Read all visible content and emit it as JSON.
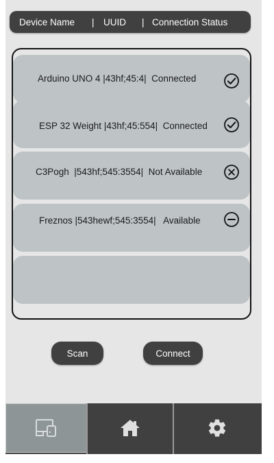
{
  "header": {
    "device_name_label": "Device Name",
    "separator": "|",
    "uuid_label": "UUID",
    "status_label": "Connection Status"
  },
  "devices": [
    {
      "name": "Arduino UNO 4",
      "uuid": "43hf;45:4",
      "status": "Connected",
      "icon": "check-circle-icon",
      "text": "Arduino UNO 4 |43hf;45:4|  Connected"
    },
    {
      "name": "ESP 32 Weight",
      "uuid": "43hf;45:554",
      "status": "Connected",
      "icon": "check-circle-icon",
      "text": "ESP 32 Weight |43hf;45:554|  Connected"
    },
    {
      "name": "C3Pogh",
      "uuid": "543hf;545:3554",
      "status": "Not Available",
      "icon": "x-circle-icon",
      "text": "C3Pogh  |543hf;545:3554|  Not Available"
    },
    {
      "name": "Freznos",
      "uuid": "543hewf;545:3554",
      "status": "Available",
      "icon": "minus-circle-icon",
      "text": "Freznos |543hewf;545:3554|   Available"
    }
  ],
  "buttons": {
    "scan_label": "Scan",
    "connect_label": "Connect"
  },
  "nav": {
    "tabs": [
      {
        "icon": "devices-icon",
        "active": true
      },
      {
        "icon": "home-icon",
        "active": false
      },
      {
        "icon": "gear-icon",
        "active": false
      }
    ]
  },
  "colors": {
    "dark": "#404040",
    "item_bg": "#bec4c6",
    "screen_bg": "#e6e6e6",
    "active_tab": "#8e9596"
  }
}
